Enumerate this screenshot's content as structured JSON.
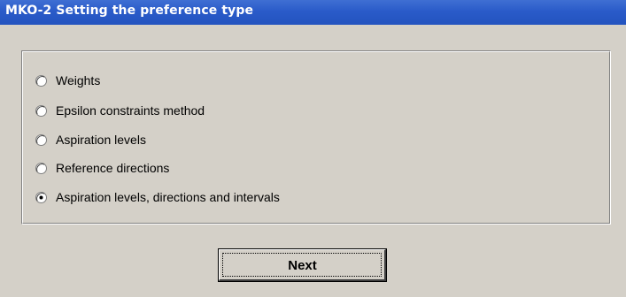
{
  "window": {
    "title": "MKO-2 Setting the preference type"
  },
  "preference_type": {
    "options": [
      {
        "label": "Weights",
        "selected": false
      },
      {
        "label": "Epsilon constraints method",
        "selected": false
      },
      {
        "label": "Aspiration levels",
        "selected": false
      },
      {
        "label": "Reference directions",
        "selected": false
      },
      {
        "label": "Aspiration levels, directions and intervals",
        "selected": true
      }
    ]
  },
  "actions": {
    "next_label": "Next"
  },
  "colors": {
    "titlebar": "#2a5bc9",
    "window_background": "#d4d0c8",
    "title_text": "#ffffff"
  }
}
